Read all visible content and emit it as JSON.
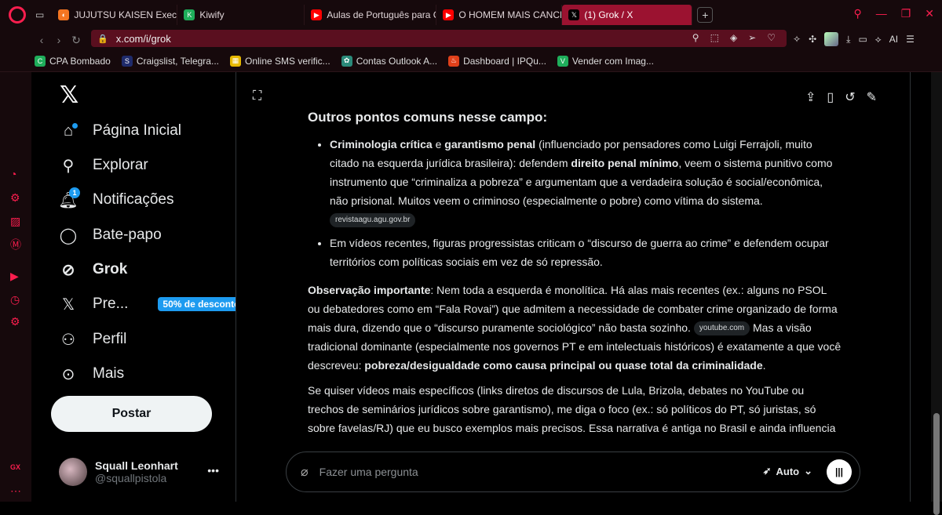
{
  "tabs": [
    {
      "title": "JUJUTSU KAISEN Execuç",
      "fav_color": "#f47521",
      "fav_glyph": "◐"
    },
    {
      "title": "Kiwify",
      "fav_color": "#1fae5b",
      "fav_glyph": "K"
    },
    {
      "title": "Aulas de Português para C",
      "fav_color": "#ff0000",
      "fav_glyph": "▶"
    },
    {
      "title": "O HOMEM MAIS CANCELA",
      "fav_color": "#ff0000",
      "fav_glyph": "▶"
    },
    {
      "title": "(1) Grok / X",
      "fav_color": "#000000",
      "fav_glyph": "𝕏",
      "active": true
    }
  ],
  "address": {
    "url": "x.com/i/grok"
  },
  "bookmarks": [
    {
      "label": "CPA Bombado",
      "fav_color": "#1fae5b",
      "fav_glyph": "C"
    },
    {
      "label": "Craigslist, Telegra...",
      "fav_color": "#1f2b6b",
      "fav_glyph": "S"
    },
    {
      "label": "Online SMS verific...",
      "fav_color": "#e6b800",
      "fav_glyph": "▦"
    },
    {
      "label": "Contas Outlook A...",
      "fav_color": "#2b8a7a",
      "fav_glyph": "✿"
    },
    {
      "label": "Dashboard | IPQu...",
      "fav_color": "#e0401a",
      "fav_glyph": "♨"
    },
    {
      "label": "Vender com Imag...",
      "fav_color": "#1fae5b",
      "fav_glyph": "V"
    }
  ],
  "nav": {
    "home": "Página Inicial",
    "explore": "Explorar",
    "notifications": "Notificações",
    "notifications_count": "1",
    "chat": "Bate-papo",
    "grok": "Grok",
    "premium": "Pre...",
    "premium_badge": "50% de desconto",
    "profile": "Perfil",
    "more": "Mais"
  },
  "post_button": "Postar",
  "user": {
    "name": "Squall Leonhart",
    "handle": "@squallpistola"
  },
  "response": {
    "heading": "Outros pontos comuns nesse campo:",
    "b1_a": "Criminologia crítica",
    "b1_b": " e ",
    "b1_c": "garantismo penal",
    "b1_d": " (influenciado por pensadores como Luigi Ferrajoli, muito citado na esquerda jurídica brasileira): defendem ",
    "b1_e": "direito penal mínimo",
    "b1_f": ", veem o sistema punitivo como instrumento que “criminaliza a pobreza” e argumentam que a verdadeira solução é social/econômica, não prisional. Muitos veem o criminoso (especialmente o pobre) como vítima do sistema.",
    "b1_chip": "revistaagu.agu.gov.br",
    "b2": "Em vídeos recentes, figuras progressistas criticam o “discurso de guerra ao crime” e defendem ocupar territórios com políticas sociais em vez de só repressão.",
    "p1_a": "Observação importante",
    "p1_b": ": Nem toda a esquerda é monolítica. Há alas mais recentes (ex.: alguns no PSOL ou debatedores como em “Fala Rovai”) que admitem a necessidade de combater crime organizado de forma mais dura, dizendo que o “discurso puramente sociológico” não basta sozinho.",
    "p1_chip": "youtube.com",
    "p1_c": " Mas a visão tradicional dominante (especialmente nos governos PT e em intelectuais históricos) é exatamente a que você descreveu: ",
    "p1_d": "pobreza/desigualdade como causa principal ou quase total da criminalidade",
    "p1_e": ".",
    "p2": "Se quiser vídeos mais específicos (links diretos de discursos de Lula, Brizola, debates no YouTube ou trechos de seminários jurídicos sobre garantismo), me diga o foco (ex.: só políticos do PT, só juristas, só sobre favelas/RJ) que eu busco exemplos mais precisos. Essa narrativa é antiga no Brasil e ainda influencia"
  },
  "composer": {
    "placeholder": "Fazer uma pergunta",
    "mode": "Auto"
  },
  "sidebar_gx_label": "GX"
}
